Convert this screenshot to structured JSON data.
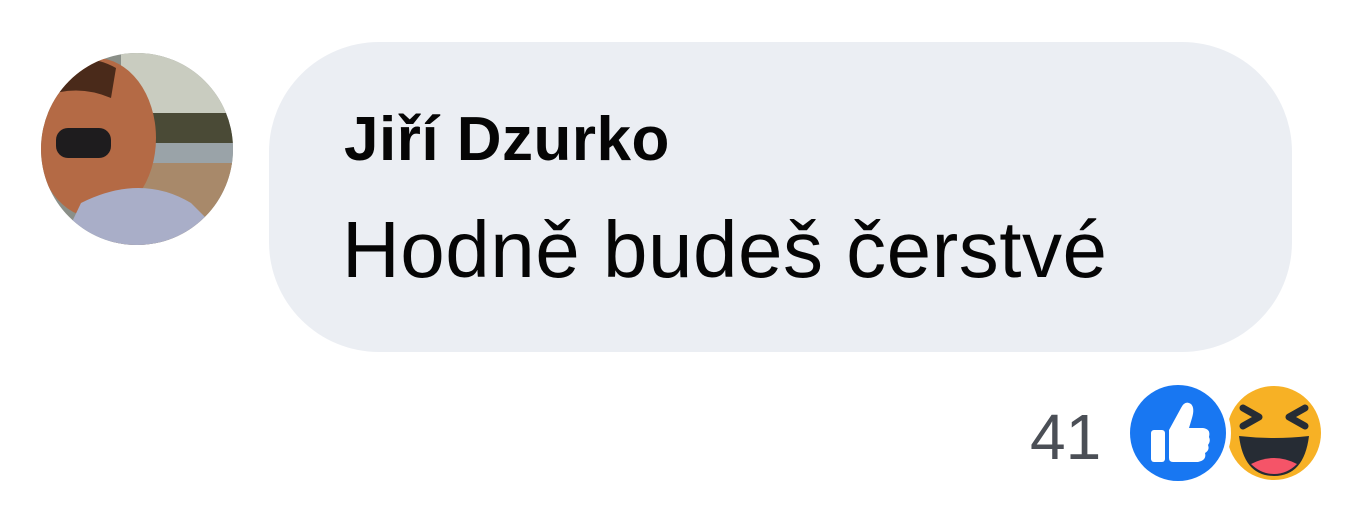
{
  "comment": {
    "author": "Jiří Dzurko",
    "text": "Hodně budeš čerstvé",
    "avatar_icon": "user-avatar-photo"
  },
  "reactions": {
    "count": "41",
    "types": [
      "like-icon",
      "haha-icon"
    ],
    "colors": {
      "like": "#1877f2",
      "haha": "#f7b125"
    }
  },
  "colors": {
    "bubble": "#ebeef3",
    "text": "#050505",
    "count_text": "#4b4f56"
  }
}
